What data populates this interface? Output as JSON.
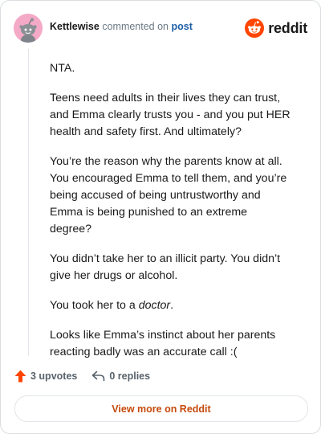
{
  "header": {
    "username": "Kettlewise",
    "commented_text": "commented on",
    "post_link": "post",
    "brand_name": "reddit"
  },
  "comment": {
    "paragraphs": {
      "p1": "NTA.",
      "p2": "Teens need adults in their lives they can trust, and Emma clearly trusts you - and you put HER health and safety first. And ultimately?",
      "p3": "You’re the reason why the parents know at all. You encouraged Emma to tell them, and you’re being accused of being untrustworthy and Emma is being punished to an extreme degree?",
      "p4": "You didn’t take her to an illicit party. You didn’t give her drugs or alcohol.",
      "p5_prefix": "You took her to a ",
      "p5_emphasis": "doctor",
      "p5_suffix": ".",
      "p6": "Looks like Emma’s instinct about her parents reacting badly was an accurate call :("
    }
  },
  "footer": {
    "upvotes": "3 upvotes",
    "replies": "0 replies",
    "view_more": "View more on Reddit"
  },
  "colors": {
    "brand_orange": "#ff4500",
    "link_blue": "#1c5fa8",
    "view_more_text": "#c54a0c",
    "avatar_bg": "#f4a9c6"
  },
  "icons": {
    "avatar": "snoo-avatar",
    "brand": "reddit-logo-icon",
    "upvote": "upvote-arrow-icon",
    "reply": "reply-arrow-icon"
  }
}
